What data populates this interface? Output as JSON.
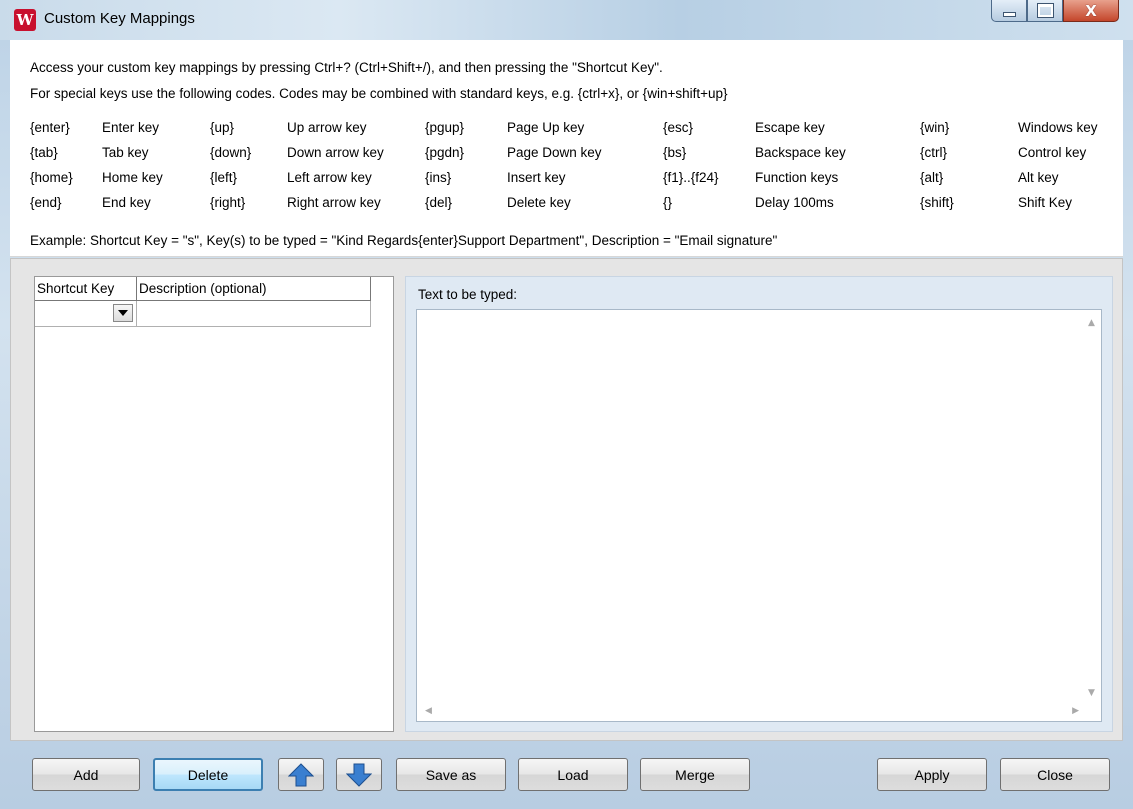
{
  "window": {
    "title": "Custom Key Mappings",
    "app_icon_letter": "W",
    "controls": {
      "minimize": "",
      "maximize": "",
      "close": "X"
    }
  },
  "info": {
    "line1": "Access your custom key mappings by pressing Ctrl+? (Ctrl+Shift+/), and then pressing the \"Shortcut Key\".",
    "line2": "For special keys use the following codes. Codes may be combined with standard keys, e.g. {ctrl+x}, or {win+shift+up}",
    "codes": [
      [
        {
          "code": "{enter}",
          "desc": "Enter key"
        },
        {
          "code": "{up}",
          "desc": "Up arrow key"
        },
        {
          "code": "{pgup}",
          "desc": "Page Up key"
        },
        {
          "code": "{esc}",
          "desc": "Escape key"
        },
        {
          "code": "{win}",
          "desc": "Windows key"
        }
      ],
      [
        {
          "code": "{tab}",
          "desc": "Tab key"
        },
        {
          "code": "{down}",
          "desc": "Down arrow key"
        },
        {
          "code": "{pgdn}",
          "desc": "Page Down key"
        },
        {
          "code": "{bs}",
          "desc": "Backspace key"
        },
        {
          "code": "{ctrl}",
          "desc": "Control key"
        }
      ],
      [
        {
          "code": "{home}",
          "desc": "Home key"
        },
        {
          "code": "{left}",
          "desc": "Left arrow key"
        },
        {
          "code": "{ins}",
          "desc": "Insert key"
        },
        {
          "code": "{f1}..{f24}",
          "desc": "Function keys"
        },
        {
          "code": "{alt}",
          "desc": "Alt key"
        }
      ],
      [
        {
          "code": "{end}",
          "desc": "End key"
        },
        {
          "code": "{right}",
          "desc": "Right arrow key"
        },
        {
          "code": "{del}",
          "desc": "Delete key"
        },
        {
          "code": "{}",
          "desc": "Delay 100ms"
        },
        {
          "code": "{shift}",
          "desc": "Shift Key"
        }
      ]
    ],
    "example": "Example: Shortcut Key = \"s\", Key(s) to be typed = \"Kind Regards{enter}Support Department\", Description = \"Email signature\""
  },
  "grid": {
    "columns": [
      "Shortcut Key",
      "Description (optional)"
    ],
    "rows": [
      {
        "shortcut_key": "",
        "description": ""
      }
    ]
  },
  "text_panel": {
    "label": "Text to be typed:",
    "value": ""
  },
  "buttons": {
    "add": "Add",
    "delete": "Delete",
    "save_as": "Save as",
    "load": "Load",
    "merge": "Merge",
    "apply": "Apply",
    "close": "Close"
  },
  "colors": {
    "arrow_blue": "#3a7fd0",
    "focus_border": "#3c7fb1",
    "close_red": "#c4462b"
  }
}
